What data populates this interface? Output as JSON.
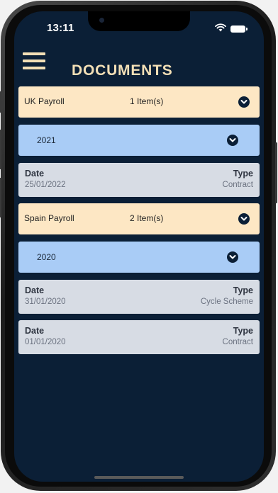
{
  "status_bar": {
    "time": "13:11",
    "icons": [
      "wifi-icon",
      "battery-icon"
    ]
  },
  "header": {
    "menu_icon": "hamburger-menu-icon",
    "title": "DOCUMENTS"
  },
  "groups": [
    {
      "payroll": "UK Payroll",
      "count": "1 Item(s)",
      "year": "2021",
      "documents": [
        {
          "date_label": "Date",
          "date": "25/01/2022",
          "type_label": "Type",
          "type": "Contract"
        }
      ]
    },
    {
      "payroll": "Spain Payroll",
      "count": "2 Item(s)",
      "year": "2020",
      "documents": [
        {
          "date_label": "Date",
          "date": "31/01/2020",
          "type_label": "Type",
          "type": "Cycle Scheme"
        },
        {
          "date_label": "Date",
          "date": "01/01/2020",
          "type_label": "Type",
          "type": "Contract"
        }
      ]
    }
  ],
  "colors": {
    "background": "#0b1f36",
    "accent": "#f3dfb6",
    "payroll_card": "#fde7c4",
    "year_card": "#a9ccf6",
    "document_card": "#d7dce4"
  }
}
